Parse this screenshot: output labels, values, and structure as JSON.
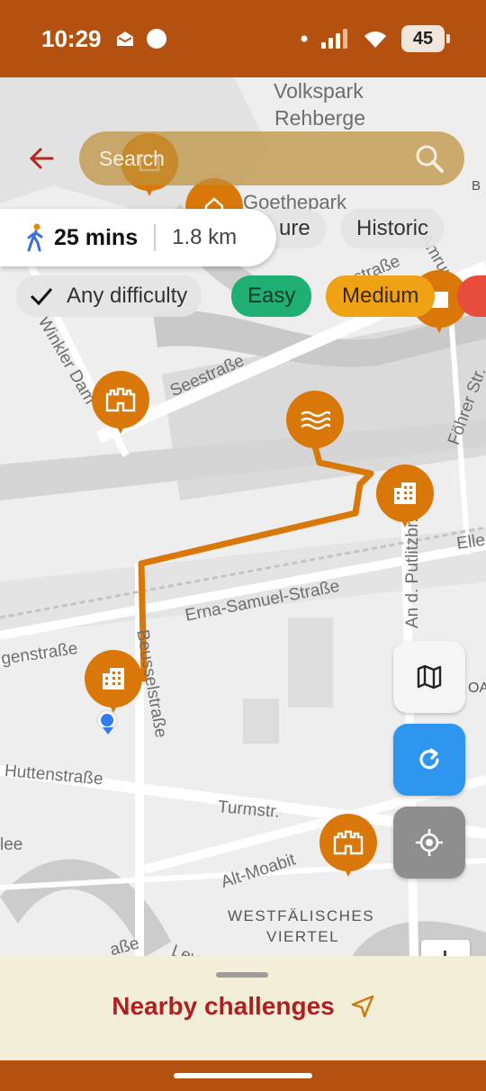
{
  "status_bar": {
    "time": "10:29",
    "battery": "45",
    "icons": [
      "mail-icon",
      "circle-icon",
      "dot-icon",
      "signal-icon",
      "wifi-icon",
      "battery-icon"
    ]
  },
  "map": {
    "labels": {
      "volkspark": "Volkspark",
      "rehberge": "Rehberge",
      "goethepark": "Goethepark",
      "seestrasse": "Seestraße",
      "ernasamuel": "Erna-Samuel-Straße",
      "beusselstrasse": "Beusselstraße",
      "huttenstrasse": "Huttenstraße",
      "turmstr": "Turmstr.",
      "altmoabit": "Alt-Moabit",
      "westfaelisches": "WESTFÄLISCHES",
      "viertel": "VIERTEL",
      "putlitz": "An d. Putlitzbr.",
      "foehrer": "Föhrer Str.",
      "zwinkler": "Winkler Dam",
      "gensstrasse": "genstraße",
      "ellen": "Elle",
      "lee": "lee",
      "b": "B",
      "oa": "OA",
      "lev": "Lev",
      "amrumer": "Amrumer",
      "strasse_top": "estraße",
      "sse_bottom": "aße"
    },
    "route_color": "#d97709",
    "marker_color": "#d97709"
  },
  "search": {
    "placeholder": "Search"
  },
  "filters": {
    "category_chips": [
      "ure",
      "Historic"
    ],
    "difficulty_chips": [
      {
        "label": "Any difficulty",
        "selected": true,
        "color": "#e4e4e4"
      },
      {
        "label": "Easy",
        "selected": false,
        "color": "#1faf72"
      },
      {
        "label": "Medium",
        "selected": false,
        "color": "#f0a215"
      }
    ]
  },
  "route": {
    "duration": "25 mins",
    "distance": "1.8 km"
  },
  "controls": {
    "map_layer": "map-icon",
    "refresh": "refresh-icon",
    "locate": "locate-icon"
  },
  "sheet": {
    "title": "Nearby challenges"
  }
}
